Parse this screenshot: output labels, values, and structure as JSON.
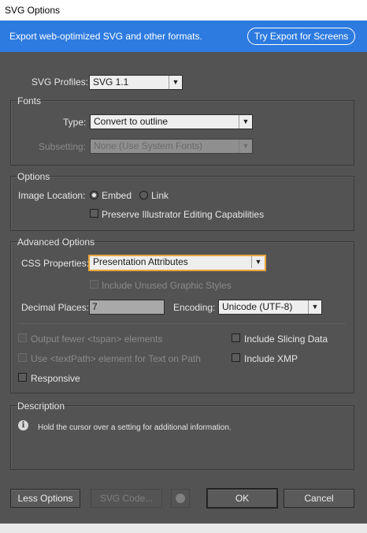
{
  "window": {
    "title": "SVG Options"
  },
  "banner": {
    "text": "Export web-optimized SVG and other formats.",
    "button_label": "Try Export for Screens",
    "color": "#2d7be0"
  },
  "profiles": {
    "label": "SVG Profiles:",
    "value": "SVG 1.1"
  },
  "fonts": {
    "title": "Fonts",
    "type_label": "Type:",
    "type_value": "Convert to outline",
    "subsetting_label": "Subsetting:",
    "subsetting_value": "None (Use System Fonts)"
  },
  "options": {
    "title": "Options",
    "image_location_label": "Image Location:",
    "embed_label": "Embed",
    "link_label": "Link",
    "selected": "Embed",
    "preserve_label": "Preserve Illustrator Editing Capabilities",
    "preserve_checked": false
  },
  "advanced": {
    "title": "Advanced Options",
    "css_label": "CSS Properties:",
    "css_value": "Presentation Attributes",
    "unused_styles_label": "Include Unused Graphic Styles",
    "decimal_label": "Decimal Places:",
    "decimal_value": "7",
    "encoding_label": "Encoding:",
    "encoding_value": "Unicode (UTF-8)",
    "tspan_label": "Output fewer <tspan> elements",
    "textpath_label": "Use <textPath> element for Text on Path",
    "responsive_label": "Responsive",
    "slicing_label": "Include Slicing Data",
    "xmp_label": "Include XMP",
    "focus_color": "#e8a33a"
  },
  "description": {
    "title": "Description",
    "text": "Hold the cursor over a setting for additional information."
  },
  "buttons": {
    "less_options": "Less Options",
    "svg_code": "SVG Code...",
    "ok": "OK",
    "cancel": "Cancel"
  }
}
